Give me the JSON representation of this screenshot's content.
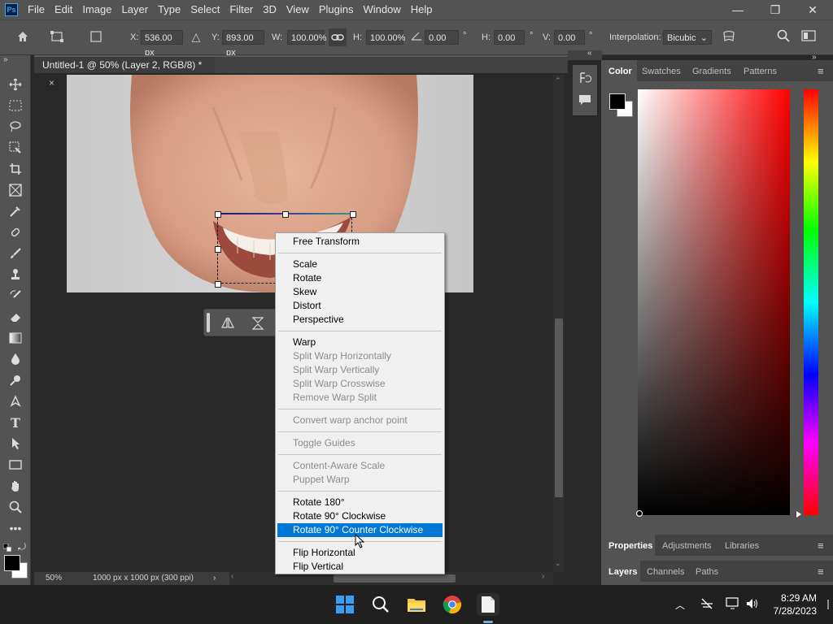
{
  "app": {
    "logo": "Ps"
  },
  "menubar": {
    "items": [
      "File",
      "Edit",
      "Image",
      "Layer",
      "Type",
      "Select",
      "Filter",
      "3D",
      "View",
      "Plugins",
      "Window",
      "Help"
    ]
  },
  "window_controls": {
    "minimize": "—",
    "maximize": "❐",
    "close": "✕"
  },
  "options": {
    "x_label": "X:",
    "x_value": "536.00 px",
    "y_label": "Y:",
    "y_value": "893.00 px",
    "w_label": "W:",
    "w_value": "100.00%",
    "h_label": "H:",
    "h_value": "100.00%",
    "angle_value": "0.00",
    "angle_unit": "°",
    "hskew_label": "H:",
    "hskew_value": "0.00",
    "hskew_unit": "°",
    "vskew_label": "V:",
    "vskew_value": "0.00",
    "vskew_unit": "°",
    "interp_label": "Interpolation:",
    "interp_value": "Bicubic"
  },
  "document": {
    "tab_title": "Untitled-1 @ 50% (Layer 2, RGB/8) *",
    "close": "×"
  },
  "status": {
    "zoom": "50%",
    "doc_info": "1000 px x 1000 px (300 ppi)"
  },
  "context_menu": {
    "groups": [
      [
        {
          "label": "Free Transform",
          "enabled": true
        }
      ],
      [
        {
          "label": "Scale",
          "enabled": true
        },
        {
          "label": "Rotate",
          "enabled": true
        },
        {
          "label": "Skew",
          "enabled": true
        },
        {
          "label": "Distort",
          "enabled": true
        },
        {
          "label": "Perspective",
          "enabled": true
        }
      ],
      [
        {
          "label": "Warp",
          "enabled": true
        },
        {
          "label": "Split Warp Horizontally",
          "enabled": false
        },
        {
          "label": "Split Warp Vertically",
          "enabled": false
        },
        {
          "label": "Split Warp Crosswise",
          "enabled": false
        },
        {
          "label": "Remove Warp Split",
          "enabled": false
        }
      ],
      [
        {
          "label": "Convert warp anchor point",
          "enabled": false
        }
      ],
      [
        {
          "label": "Toggle Guides",
          "enabled": false
        }
      ],
      [
        {
          "label": "Content-Aware Scale",
          "enabled": false
        },
        {
          "label": "Puppet Warp",
          "enabled": false
        }
      ],
      [
        {
          "label": "Rotate 180°",
          "enabled": true
        },
        {
          "label": "Rotate 90° Clockwise",
          "enabled": true
        },
        {
          "label": "Rotate 90° Counter Clockwise",
          "enabled": true,
          "highlighted": true
        }
      ],
      [
        {
          "label": "Flip Horizontal",
          "enabled": true
        },
        {
          "label": "Flip Vertical",
          "enabled": true
        }
      ]
    ]
  },
  "panels": {
    "color_tabs": [
      "Color",
      "Swatches",
      "Gradients",
      "Patterns"
    ],
    "properties_tabs": [
      "Properties",
      "Adjustments",
      "Libraries"
    ],
    "layers_tabs": [
      "Layers",
      "Channels",
      "Paths"
    ]
  },
  "taskbar": {
    "time": "8:29 AM",
    "date": "7/28/2023"
  },
  "colors": {
    "menu_highlight": "#0078d7",
    "accent": "#31a8ff",
    "foreground": "#000000",
    "background": "#ffffff"
  }
}
